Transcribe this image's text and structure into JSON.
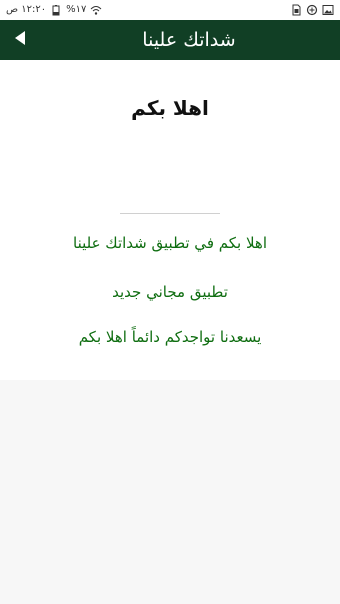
{
  "status_bar": {
    "time": "١٢:٢٠ ص",
    "battery": "%١٧",
    "icons": [
      "wifi-icon",
      "battery-icon",
      "gallery-icon",
      "data-saver-icon",
      "sim-icon"
    ]
  },
  "app_bar": {
    "title": "شداتك علينا",
    "back_icon": "back-arrow-icon",
    "background": "#113f25"
  },
  "content": {
    "heading": "اهلا بكم",
    "messages": [
      "اهلا بكم في تطبيق شداتك علينا",
      "تطبيق مجاني جديد",
      "يسعدنا تواجدكم دائماً اهلا بكم"
    ],
    "message_color": "#0e6d10"
  }
}
